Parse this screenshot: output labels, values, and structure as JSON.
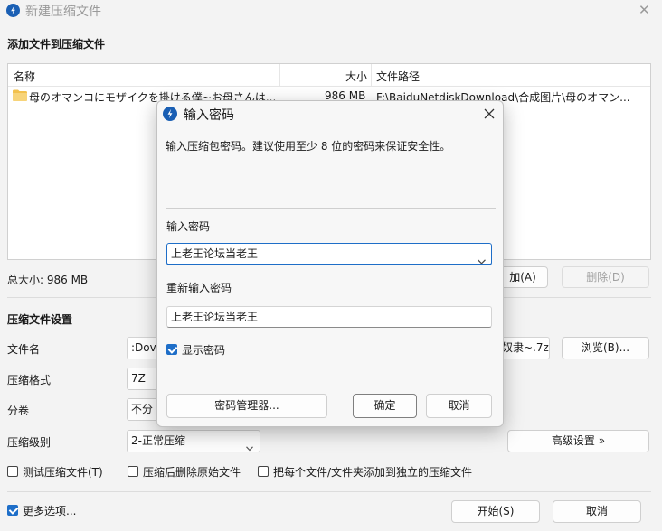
{
  "window": {
    "title": "新建压缩文件",
    "close_glyph": "✕"
  },
  "section_add": {
    "title": "添加文件到压缩文件"
  },
  "file_table": {
    "columns": [
      "名称",
      "大小",
      "文件路径"
    ],
    "rows": [
      {
        "name": "母のオマンコにモザイクを掛ける僕~お母さんは...",
        "size": "986 MB",
        "path": "F:\\BaiduNetdiskDownload\\合成图片\\母のオマン..."
      }
    ]
  },
  "total_size": "总大小: 986 MB",
  "add_button_partial": "加(A)",
  "delete_button": "删除(D)",
  "section_settings": {
    "title": "压缩文件设置"
  },
  "settings": {
    "filename_label": "文件名",
    "filename_value": ":Dov",
    "filename_suffix": "奴隶~.7z",
    "browse_button": "浏览(B)...",
    "format_label": "压缩格式",
    "format_value": "7Z",
    "volume_label": "分卷",
    "volume_value": "不分",
    "level_label": "压缩级别",
    "level_value": "2-正常压缩",
    "advanced_button": "高级设置 »"
  },
  "options": {
    "test_archive": "测试压缩文件(T)",
    "delete_after": "压缩后删除原始文件",
    "separate_archives": "把每个文件/文件夹添加到独立的压缩文件"
  },
  "footer": {
    "more_options": "更多选项...",
    "start_button": "开始(S)",
    "cancel_button": "取消"
  },
  "dialog": {
    "title": "输入密码",
    "description": "输入压缩包密码。建议使用至少 8 位的密码来保证安全性。",
    "password_label": "输入密码",
    "password_value": "上老王论坛当老王",
    "repeat_label": "重新输入密码",
    "repeat_value": "上老王论坛当老王",
    "show_password": "显示密码",
    "manager_button": "密码管理器...",
    "ok_button": "确定",
    "cancel_button": "取消"
  },
  "colors": {
    "accent": "#1e6ec8",
    "app_icon": "#1a5fb4",
    "folder": "#f2c14e"
  }
}
